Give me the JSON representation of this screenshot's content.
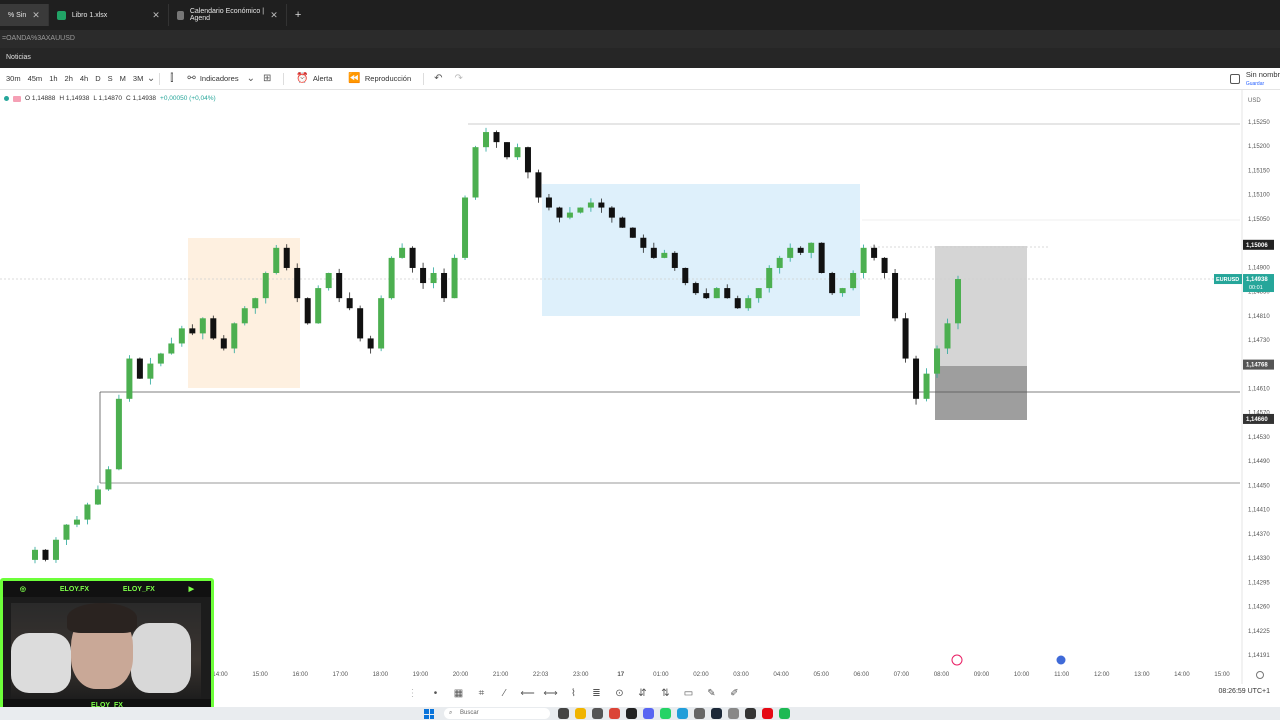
{
  "browser": {
    "tabs": [
      {
        "label": "% Sin",
        "color": "#2962ff",
        "active": true
      },
      {
        "label": "Libro 1.xlsx",
        "color": "#21a366",
        "active": false
      },
      {
        "label": "Calendario Económico | Agend",
        "color": "#777777",
        "active": false
      }
    ],
    "new_tab": "+",
    "url": "=OANDA%3AXAUUSD",
    "notifications": "Noticias"
  },
  "toolbar": {
    "timeframes": [
      "30m",
      "45m",
      "1h",
      "2h",
      "4h",
      "D",
      "S",
      "M",
      "3M"
    ],
    "indicators": "Indicadores",
    "alert": "Alerta",
    "replay": "Reproducción",
    "save_title": "Sin nombr",
    "save_sub": "Guardar"
  },
  "ohlc": {
    "o": "O 1,14888",
    "h": "H 1,14938",
    "l": "L 1,14870",
    "c": "C 1,14938",
    "chg": "+0,00050 (+0,04%)"
  },
  "chart_data": {
    "type": "candlestick",
    "symbol": "EURUSD",
    "currency": "USD",
    "y_ticks": [
      "1,15250",
      "1,15200",
      "1,15150",
      "1,15100",
      "1,15050",
      "1,14950",
      "1,14900",
      "1,14850",
      "1,14810",
      "1,14730",
      "1,14690",
      "1,14610",
      "1,14570",
      "1,14530",
      "1,14490",
      "1,14450",
      "1,14410",
      "1,14370",
      "1,14330",
      "1,14295",
      "1,14260",
      "1,14225",
      "1,14191"
    ],
    "x_ticks": [
      "14:00",
      "15:00",
      "16:00",
      "17:00",
      "18:00",
      "19:00",
      "20:00",
      "21:00",
      "22:03",
      "23:00",
      "17",
      "01:00",
      "02:00",
      "03:00",
      "04:00",
      "05:00",
      "06:00",
      "07:00",
      "08:00",
      "09:00",
      "10:00",
      "11:00",
      "12:00",
      "13:00",
      "14:00",
      "15:00"
    ],
    "price_labels": [
      {
        "text": "1,15006",
        "color": "#222222",
        "price": 1.15006
      },
      {
        "text": "1,14938",
        "color": "#26a69a",
        "price": 1.14938,
        "sub": "00:01",
        "symbol_tag": "EURUSD"
      },
      {
        "text": "1,14768",
        "color": "#555555",
        "price": 1.14768
      },
      {
        "text": "1,14660",
        "color": "#333333",
        "price": 1.1466
      }
    ],
    "closes": [
      1.144,
      1.1438,
      1.1442,
      1.1445,
      1.1446,
      1.1449,
      1.1452,
      1.1456,
      1.147,
      1.1478,
      1.1474,
      1.1477,
      1.1479,
      1.1481,
      1.1484,
      1.1483,
      1.1486,
      1.1482,
      1.148,
      1.1485,
      1.1488,
      1.149,
      1.1495,
      1.15,
      1.1496,
      1.149,
      1.1485,
      1.1492,
      1.1495,
      1.149,
      1.1488,
      1.1482,
      1.148,
      1.149,
      1.1498,
      1.15,
      1.1496,
      1.1493,
      1.1495,
      1.149,
      1.1498,
      1.151,
      1.152,
      1.1523,
      1.1521,
      1.1518,
      1.152,
      1.1515,
      1.151,
      1.1508,
      1.1506,
      1.1507,
      1.1508,
      1.1509,
      1.1508,
      1.1506,
      1.1504,
      1.1502,
      1.15,
      1.1498,
      1.1499,
      1.1496,
      1.1493,
      1.1491,
      1.149,
      1.1492,
      1.149,
      1.1488,
      1.149,
      1.1492,
      1.1496,
      1.1498,
      1.15,
      1.1499,
      1.1501,
      1.1495,
      1.1491,
      1.1492,
      1.1495,
      1.15,
      1.1498,
      1.1495,
      1.1486,
      1.1478,
      1.147,
      1.1475,
      1.148,
      1.1485,
      1.14938
    ]
  },
  "webcam": {
    "left_handle": "ELOY.FX",
    "right_handle": "ELOY_FX",
    "name": "ELOY_FX"
  },
  "status": {
    "clock": "08:26:59 UTC+1"
  },
  "taskbar": {
    "search": "Buscar"
  }
}
